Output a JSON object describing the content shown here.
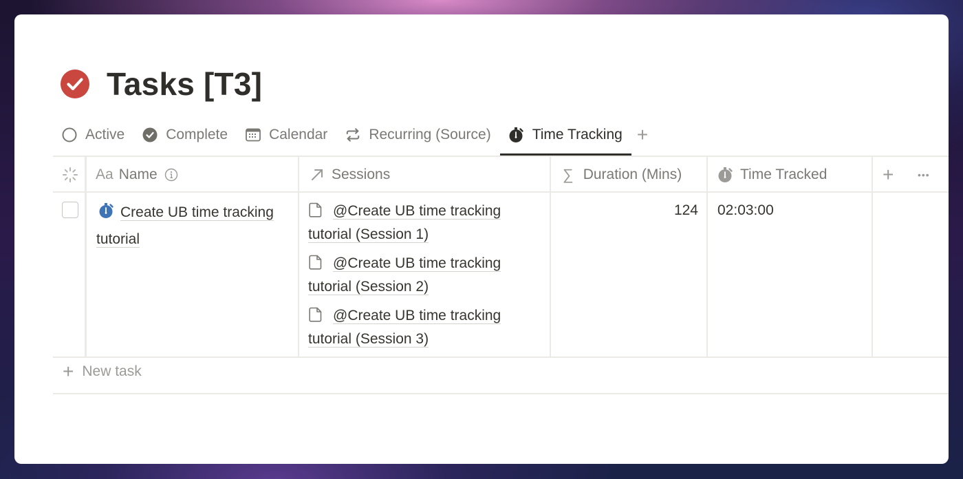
{
  "page": {
    "title": "Tasks [T3]",
    "title_icon": "checkmark-circle-icon",
    "accent_color": "#c9473e"
  },
  "tabs": [
    {
      "label": "Active",
      "icon": "circle-outline-icon",
      "active": false
    },
    {
      "label": "Complete",
      "icon": "check-circle-icon",
      "active": false
    },
    {
      "label": "Calendar",
      "icon": "calendar-icon",
      "active": false
    },
    {
      "label": "Recurring (Source)",
      "icon": "repeat-icon",
      "active": false
    },
    {
      "label": "Time Tracking",
      "icon": "stopwatch-icon",
      "active": true
    }
  ],
  "add_view_label": "+",
  "table": {
    "columns": [
      {
        "label": "Name",
        "type_icon": "text-type-icon",
        "type_prefix": "Aa",
        "info_icon": "info-icon"
      },
      {
        "label": "Sessions",
        "type_icon": "relation-arrow-icon"
      },
      {
        "label": "Duration (Mins)",
        "type_icon": "sigma-icon"
      },
      {
        "label": "Time Tracked",
        "type_icon": "stopwatch-icon"
      }
    ],
    "add_column_label": "+",
    "more_label": "•••",
    "rows": [
      {
        "checked": false,
        "name": "Create UB time tracking tutorial",
        "name_icon": "stopwatch-blue-icon",
        "sessions": [
          "@Create UB time tracking tutorial (Session 1)",
          "@Create UB time tracking tutorial (Session 2)",
          "@Create UB time tracking tutorial (Session 3)"
        ],
        "duration_mins": "124",
        "time_tracked": "02:03:00"
      }
    ],
    "new_row_label": "New task"
  }
}
